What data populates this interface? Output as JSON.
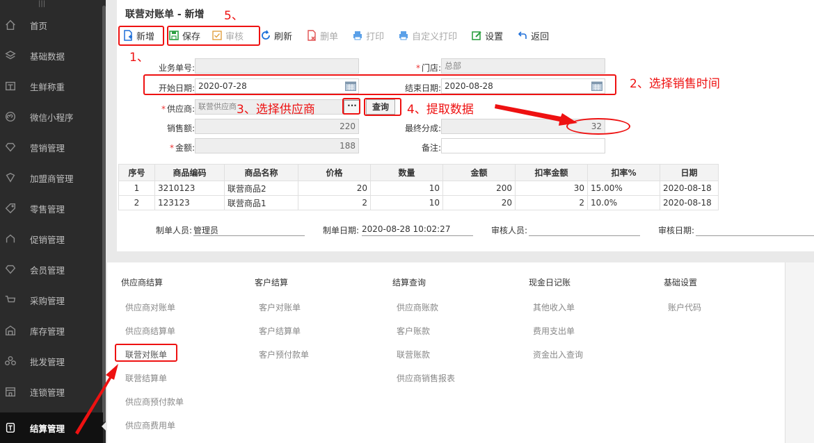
{
  "sidebar": {
    "items": [
      {
        "label": "首页",
        "icon": "home-icon"
      },
      {
        "label": "基础数据",
        "icon": "layers-icon"
      },
      {
        "label": "生鲜称重",
        "icon": "scale-icon"
      },
      {
        "label": "微信小程序",
        "icon": "wechat-mini-icon"
      },
      {
        "label": "营销管理",
        "icon": "diamond-icon"
      },
      {
        "label": "加盟商管理",
        "icon": "franchise-icon"
      },
      {
        "label": "零售管理",
        "icon": "tag-icon"
      },
      {
        "label": "促销管理",
        "icon": "promo-icon"
      },
      {
        "label": "会员管理",
        "icon": "member-icon"
      },
      {
        "label": "采购管理",
        "icon": "cart-icon"
      },
      {
        "label": "库存管理",
        "icon": "warehouse-icon"
      },
      {
        "label": "批发管理",
        "icon": "wholesale-icon"
      },
      {
        "label": "连锁管理",
        "icon": "chain-store-icon"
      },
      {
        "label": "结算管理",
        "icon": "settlement-icon"
      }
    ]
  },
  "form": {
    "title": "联营对账单 - 新增",
    "toolbar": {
      "new": "新增",
      "save": "保存",
      "audit": "审核",
      "refresh": "刷新",
      "delete": "删单",
      "print": "打印",
      "custom_print": "自定义打印",
      "settings": "设置",
      "back": "返回"
    },
    "fields": {
      "doc_no_label": "业务单号:",
      "doc_no_value": "",
      "store_label": "门店:",
      "store_value": "总部",
      "start_date_label": "开始日期:",
      "start_date_value": "2020-07-28",
      "end_date_label": "结束日期:",
      "end_date_value": "2020-08-28",
      "supplier_label": "供应商:",
      "supplier_value": "联营供应商",
      "query_button": "查询",
      "sales_label": "销售额:",
      "sales_value": "220",
      "final_share_label": "最终分成:",
      "final_share_value": "32",
      "amount_label": "金额:",
      "amount_value": "188",
      "remark_label": "备注:",
      "remark_value": ""
    },
    "table": {
      "headers": [
        "序号",
        "商品编码",
        "商品名称",
        "价格",
        "数量",
        "金额",
        "扣率金额",
        "扣率%",
        "日期"
      ],
      "rows": [
        [
          "1",
          "3210123",
          "联营商品2",
          "20",
          "10",
          "200",
          "30",
          "15.00%",
          "2020-08-18"
        ],
        [
          "2",
          "123123",
          "联营商品1",
          "2",
          "10",
          "20",
          "2",
          "10.0%",
          "2020-08-18"
        ]
      ]
    },
    "footer": {
      "creator_label": "制单人员:",
      "creator_value": "管理员",
      "created_at_label": "制单日期:",
      "created_at_value": "2020-08-28 10:02:27",
      "auditor_label": "审核人员:",
      "auditor_value": "",
      "audit_date_label": "审核日期:",
      "audit_date_value": ""
    }
  },
  "menu": {
    "columns": [
      {
        "title": "供应商结算",
        "links": [
          "供应商对账单",
          "供应商结算单",
          "联营对账单",
          "联营结算单",
          "供应商预付款单",
          "供应商费用单"
        ]
      },
      {
        "title": "客户结算",
        "links": [
          "客户对账单",
          "客户结算单",
          "客户预付款单"
        ]
      },
      {
        "title": "结算查询",
        "links": [
          "供应商账款",
          "客户账款",
          "联营账款",
          "供应商销售报表"
        ]
      },
      {
        "title": "现金日记账",
        "links": [
          "其他收入单",
          "费用支出单",
          "资金出入查询"
        ]
      },
      {
        "title": "基础设置",
        "links": [
          "账户代码"
        ]
      }
    ]
  },
  "annotations": {
    "step1": "1、",
    "step2": "2、选择销售时间",
    "step3": "3、选择供应商",
    "step4": "4、提取数据",
    "step5": "5、"
  },
  "colors": {
    "annotation_red": "#e11111",
    "sidebar_bg": "#2b2b2b",
    "toolbar_blue": "#1e6fd9",
    "toolbar_green": "#2ea043"
  }
}
